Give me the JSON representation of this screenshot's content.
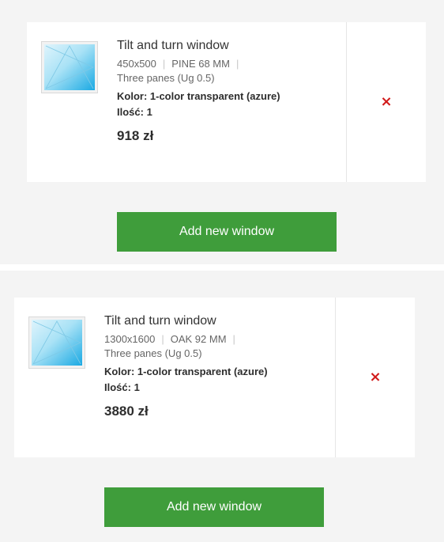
{
  "items": [
    {
      "title": "Tilt and turn window",
      "dimensions": "450x500",
      "profile": "PINE 68 MM",
      "glazing": "Three panes (Ug 0.5)",
      "color_label": "Kolor: 1-color transparent (azure)",
      "quantity_label": "Ilość: 1",
      "price": "918 zł",
      "remove_icon": "×"
    },
    {
      "title": "Tilt and turn window",
      "dimensions": "1300x1600",
      "profile": "OAK 92 MM",
      "glazing": "Three panes (Ug 0.5)",
      "color_label": "Kolor: 1-color transparent (azure)",
      "quantity_label": "Ilość: 1",
      "price": "3880 zł",
      "remove_icon": "×"
    }
  ],
  "add_button_label": "Add new window",
  "colors": {
    "panel_bg": "#f4f4f4",
    "button_green": "#3f9d3b",
    "remove_red": "#d11a1a",
    "glass_blue": "#29b6e8"
  },
  "icons": {
    "thumbnail": "window-thumbnail-icon",
    "remove": "close-icon"
  }
}
